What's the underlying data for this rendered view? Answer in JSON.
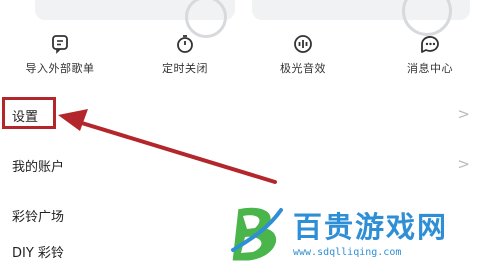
{
  "shortcuts": [
    {
      "label": "导入外部歌单",
      "icon": "import-playlist-icon"
    },
    {
      "label": "定时关闭",
      "icon": "timer-icon"
    },
    {
      "label": "极光音效",
      "icon": "sound-effect-icon"
    },
    {
      "label": "消息中心",
      "icon": "message-icon"
    }
  ],
  "menu": {
    "settings": "设置",
    "account": "我的账户",
    "ringtone_square": "彩铃广场",
    "diy_ringtone": "DIY 彩铃",
    "chevron": ">"
  },
  "annotation": {
    "box_color": "#b3262c",
    "arrow_color": "#b3262c"
  },
  "watermark": {
    "title": "百贵游戏网",
    "url": "www.sdqlliqing.com",
    "color": "#2f8fd6"
  }
}
